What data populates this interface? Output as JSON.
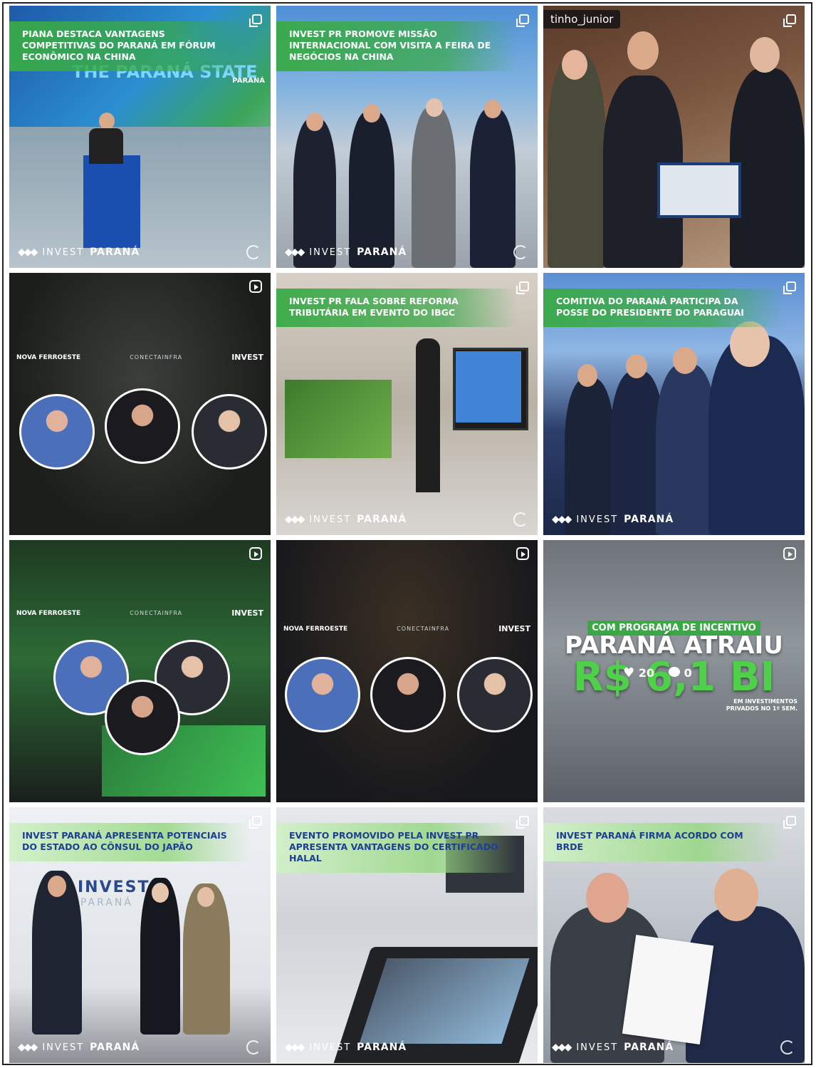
{
  "brand": {
    "invest": "INVEST",
    "parana": "PARANÁ",
    "parana_plain": "PARANA"
  },
  "partners": {
    "nova_ferroeste": "NOVA FERROESTE",
    "conecta": "CONECTAINFRA",
    "invest": "INVEST",
    "parana": "PARANA"
  },
  "posts": [
    {
      "caption": "PIANA DESTACA VANTAGENS COMPETITIVAS DO PARANÁ EM FÓRUM ECONÔMICO NA CHINA",
      "stage_text": "THE PARANÁ STATE",
      "stage_side": "PARANÁ"
    },
    {
      "caption": "INVEST PR PROMOVE MISSÃO INTERNACIONAL COM VISITA A FEIRA DE NEGÓCIOS NA CHINA"
    },
    {
      "username": "tinho_junior"
    },
    {
      "type": "reel-partners"
    },
    {
      "caption": "INVEST PR FALA SOBRE REFORMA TRIBUTÁRIA EM EVENTO DO IBGC"
    },
    {
      "caption": "COMITIVA DO PARANÁ PARTICIPA DA POSSE DO PRESIDENTE DO PARAGUAI"
    },
    {
      "type": "reel-partners"
    },
    {
      "type": "reel-partners"
    },
    {
      "headline_top": "COM PROGRAMA DE INCENTIVO",
      "headline_mid": "PARANÁ ATRAIU",
      "headline_big": "R$ 6,1 BI",
      "headline_small": "EM INVESTIMENTOS PRIVADOS NO 1º SEM.",
      "likes": "20",
      "comments": "0"
    },
    {
      "caption": "INVEST PARANÁ APRESENTA POTENCIAIS DO ESTADO AO CÔNSUL DO JAPÃO",
      "wall_logo": "INVEST",
      "wall_logo_sub": "PARANÁ"
    },
    {
      "caption": "EVENTO PROMOVIDO PELA INVEST PR APRESENTA VANTAGENS DO CERTIFICADO HALAL"
    },
    {
      "caption": "INVEST PARANÁ FIRMA ACORDO COM BRDE"
    }
  ]
}
